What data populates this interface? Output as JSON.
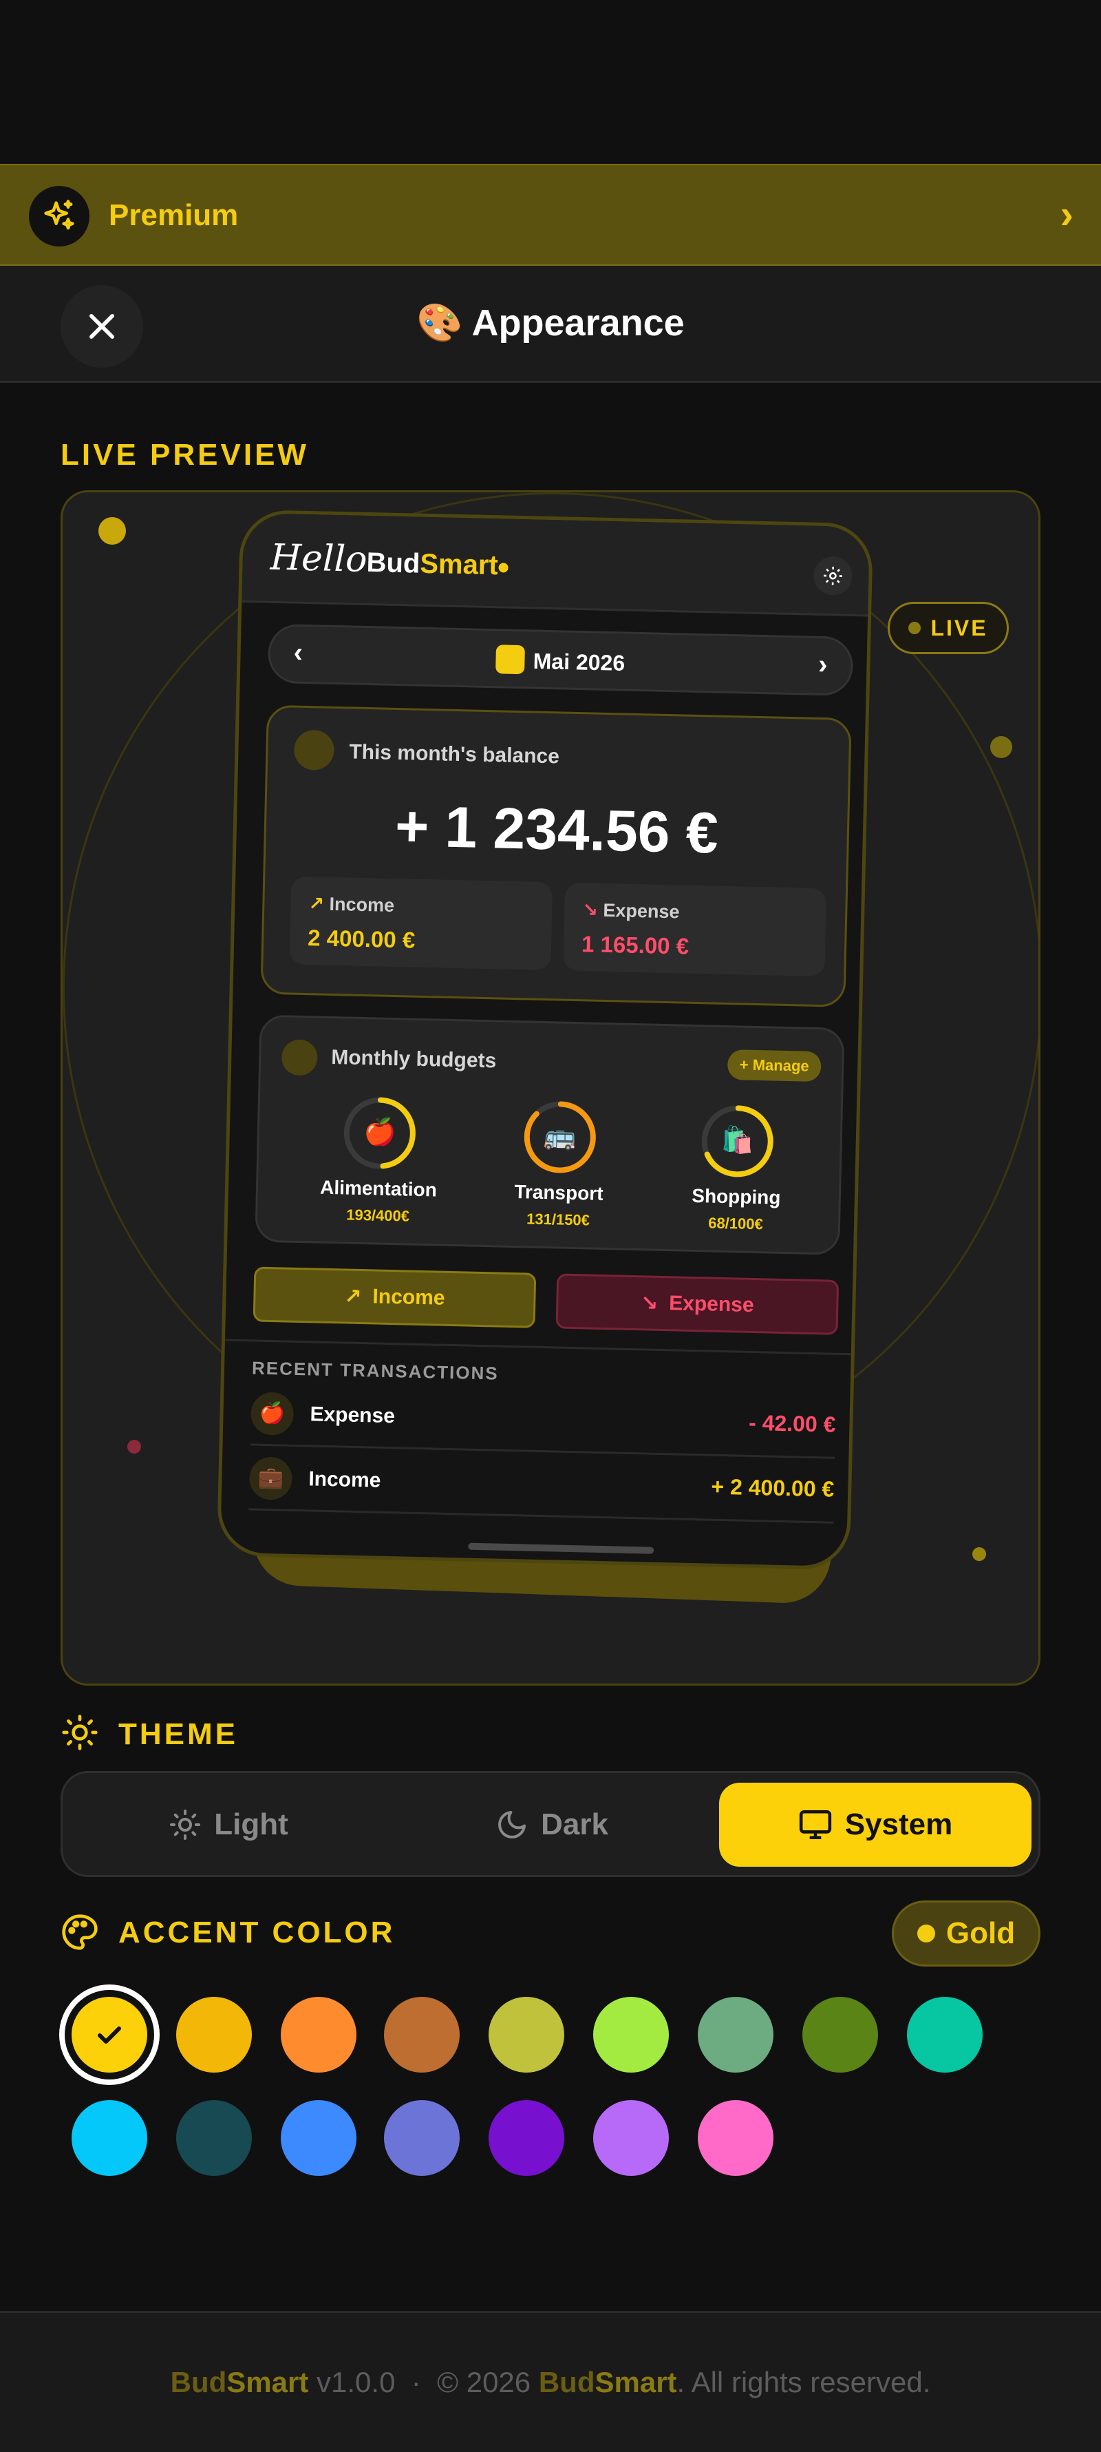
{
  "premium": {
    "label": "Premium",
    "chevron": "›",
    "icon": "sparkles-icon"
  },
  "header": {
    "title": "🎨 Appearance",
    "close_icon": "close-icon"
  },
  "preview": {
    "section_label": "LIVE PREVIEW",
    "live_badge": "LIVE",
    "phone": {
      "hello": "Hello",
      "brand_part1": "Bud",
      "brand_part2": "Smart",
      "month_label": "Mai 2026",
      "prev_arrow": "‹",
      "next_arrow": "›",
      "balance_title": "This month's balance",
      "balance_amount": "+ 1 234.56 €",
      "income_label": "Income",
      "income_value": "2 400.00 €",
      "expense_label": "Expense",
      "expense_value": "1 165.00 €",
      "budgets_title": "Monthly budgets",
      "manage_label": "+ Manage",
      "budgets": [
        {
          "emoji": "🍎",
          "name": "Alimentation",
          "value": "193/400€",
          "progress": 0.48,
          "color": "#f4cc10"
        },
        {
          "emoji": "🚌",
          "name": "Transport",
          "value": "131/150€",
          "progress": 0.87,
          "color": "#f59a10"
        },
        {
          "emoji": "🛍️",
          "name": "Shopping",
          "value": "68/100€",
          "progress": 0.68,
          "color": "#f4cc10"
        }
      ],
      "income_button": "Income",
      "expense_button": "Expense",
      "recent_header": "RECENT TRANSACTIONS",
      "transactions": [
        {
          "emoji": "🍎",
          "label": "Expense",
          "value": "- 42.00 €",
          "color": "#ff4d6a"
        },
        {
          "emoji": "💼",
          "label": "Income",
          "value": "+ 2 400.00 €",
          "color": "#f4cc10"
        }
      ]
    }
  },
  "theme": {
    "section_label": "THEME",
    "options": [
      {
        "label": "Light",
        "icon": "sun-icon"
      },
      {
        "label": "Dark",
        "icon": "moon-icon"
      },
      {
        "label": "System",
        "icon": "monitor-icon"
      }
    ],
    "selected": "System"
  },
  "accent": {
    "section_label": "ACCENT COLOR",
    "selected_name": "Gold",
    "swatches": [
      "#fcd10a",
      "#f2b707",
      "#fe8c2f",
      "#bd6e30",
      "#c0c23b",
      "#a4eb41",
      "#6dab80",
      "#5b8417",
      "#06c7a2",
      "#05c8fa",
      "#174a52",
      "#3d8aff",
      "#6c74d7",
      "#7711cf",
      "#b76af8",
      "#ff6ac8"
    ]
  },
  "footer": {
    "brand_part1": "Bud",
    "brand_part2": "Smart",
    "version": " v1.0.0  ·  © 2026 ",
    "brand2_part1": "Bud",
    "brand2_part2": "Smart",
    "rights": ". All rights reserved."
  },
  "colors": {
    "accent": "#f4cc10",
    "expense": "#ff4d6a",
    "background": "#101010"
  }
}
